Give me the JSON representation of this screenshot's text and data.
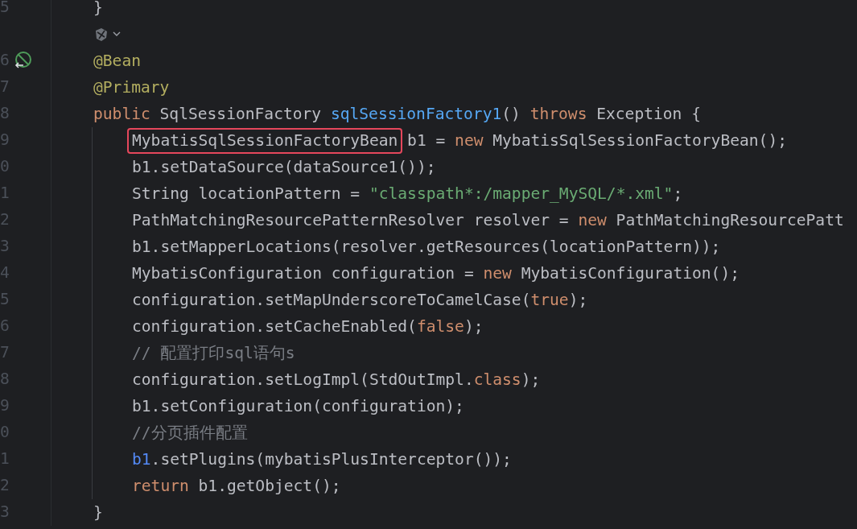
{
  "editor": {
    "rows": [
      {
        "kind": "code",
        "number": "5",
        "in_body": false,
        "tokens": [
          {
            "text": "}",
            "kind": "plain"
          }
        ]
      },
      {
        "kind": "inlay",
        "in_body": false
      },
      {
        "kind": "code",
        "number": "6",
        "in_body": false,
        "gutter_marker": true,
        "tokens": [
          {
            "text": "@Bean",
            "kind": "annotation"
          }
        ]
      },
      {
        "kind": "code",
        "number": "7",
        "in_body": false,
        "tokens": [
          {
            "text": "@Primary",
            "kind": "annotation"
          }
        ]
      },
      {
        "kind": "code",
        "number": "8",
        "in_body": false,
        "tokens": [
          {
            "text": "public",
            "kind": "keyword"
          },
          {
            "text": " SqlSessionFactory ",
            "kind": "plain"
          },
          {
            "text": "sqlSessionFactory1",
            "kind": "method"
          },
          {
            "text": "() ",
            "kind": "plain"
          },
          {
            "text": "throws",
            "kind": "keyword"
          },
          {
            "text": " Exception {",
            "kind": "plain"
          }
        ]
      },
      {
        "kind": "code",
        "number": "9",
        "in_body": true,
        "tokens": [
          {
            "text": "MybatisSqlSessionFactoryBean",
            "kind": "plain",
            "boxed": true
          },
          {
            "text": " b1 = ",
            "kind": "plain"
          },
          {
            "text": "new",
            "kind": "keyword"
          },
          {
            "text": " MybatisSqlSessionFactoryBean();",
            "kind": "plain"
          }
        ]
      },
      {
        "kind": "code",
        "number": "0",
        "in_body": true,
        "tokens": [
          {
            "text": "b1.setDataSource(dataSource1());",
            "kind": "plain"
          }
        ]
      },
      {
        "kind": "code",
        "number": "1",
        "in_body": true,
        "tokens": [
          {
            "text": "String locationPattern = ",
            "kind": "plain"
          },
          {
            "text": "\"classpath*:/mapper_MySQL/*.xml\"",
            "kind": "string"
          },
          {
            "text": ";",
            "kind": "plain"
          }
        ]
      },
      {
        "kind": "code",
        "number": "2",
        "in_body": true,
        "tokens": [
          {
            "text": "PathMatchingResourcePatternResolver resolver = ",
            "kind": "plain"
          },
          {
            "text": "new",
            "kind": "keyword"
          },
          {
            "text": " PathMatchingResourcePatt",
            "kind": "plain"
          }
        ]
      },
      {
        "kind": "code",
        "number": "3",
        "in_body": true,
        "tokens": [
          {
            "text": "b1.setMapperLocations(resolver.getResources(locationPattern));",
            "kind": "plain"
          }
        ]
      },
      {
        "kind": "code",
        "number": "4",
        "in_body": true,
        "tokens": [
          {
            "text": "MybatisConfiguration configuration = ",
            "kind": "plain"
          },
          {
            "text": "new",
            "kind": "keyword"
          },
          {
            "text": " MybatisConfiguration();",
            "kind": "plain"
          }
        ]
      },
      {
        "kind": "code",
        "number": "5",
        "in_body": true,
        "tokens": [
          {
            "text": "configuration.setMapUnderscoreToCamelCase(",
            "kind": "plain"
          },
          {
            "text": "true",
            "kind": "keyword"
          },
          {
            "text": ");",
            "kind": "plain"
          }
        ]
      },
      {
        "kind": "code",
        "number": "6",
        "in_body": true,
        "tokens": [
          {
            "text": "configuration.setCacheEnabled(",
            "kind": "plain"
          },
          {
            "text": "false",
            "kind": "keyword"
          },
          {
            "text": ");",
            "kind": "plain"
          }
        ]
      },
      {
        "kind": "code",
        "number": "7",
        "in_body": true,
        "tokens": [
          {
            "text": "// 配置打印sql语句s",
            "kind": "comment"
          }
        ]
      },
      {
        "kind": "code",
        "number": "8",
        "in_body": true,
        "tokens": [
          {
            "text": "configuration.setLogImpl(StdOutImpl.",
            "kind": "plain"
          },
          {
            "text": "class",
            "kind": "keyword"
          },
          {
            "text": ");",
            "kind": "plain"
          }
        ]
      },
      {
        "kind": "code",
        "number": "9",
        "in_body": true,
        "tokens": [
          {
            "text": "b1.setConfiguration(configuration);",
            "kind": "plain"
          }
        ]
      },
      {
        "kind": "code",
        "number": "0",
        "in_body": true,
        "tokens": [
          {
            "text": "//分页插件配置",
            "kind": "comment"
          }
        ]
      },
      {
        "kind": "code",
        "number": "1",
        "in_body": true,
        "tokens": [
          {
            "text": "b1",
            "kind": "variable"
          },
          {
            "text": ".setPlugins(mybatisPlusInterceptor());",
            "kind": "plain"
          }
        ]
      },
      {
        "kind": "code",
        "number": "2",
        "in_body": true,
        "tokens": [
          {
            "text": "return",
            "kind": "keyword"
          },
          {
            "text": " b1.getObject();",
            "kind": "plain"
          }
        ]
      },
      {
        "kind": "code",
        "number": "3",
        "in_body": false,
        "tokens": [
          {
            "text": "}",
            "kind": "plain"
          }
        ]
      }
    ]
  }
}
